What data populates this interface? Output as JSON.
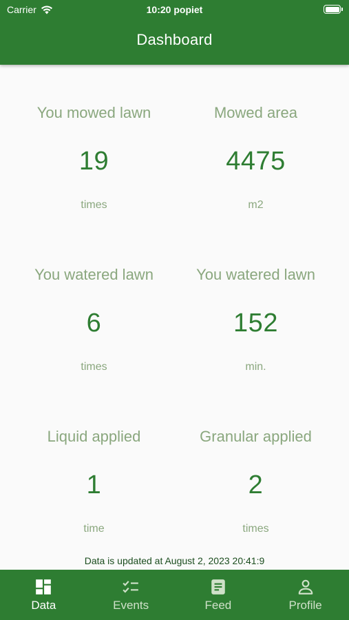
{
  "status_bar": {
    "carrier": "Carrier",
    "time": "10:20 popiet"
  },
  "header": {
    "title": "Dashboard"
  },
  "stats": [
    {
      "label": "You mowed lawn",
      "value": "19",
      "unit": "times"
    },
    {
      "label": "Mowed area",
      "value": "4475",
      "unit": "m2"
    },
    {
      "label": "You watered lawn",
      "value": "6",
      "unit": "times"
    },
    {
      "label": "You watered lawn",
      "value": "152",
      "unit": "min."
    },
    {
      "label": "Liquid applied",
      "value": "1",
      "unit": "time"
    },
    {
      "label": "Granular applied",
      "value": "2",
      "unit": "times"
    }
  ],
  "updated_text": "Data is updated at August 2, 2023 20:41:9",
  "nav": {
    "items": [
      {
        "label": "Data",
        "icon": "dashboard-icon",
        "active": true
      },
      {
        "label": "Events",
        "icon": "checklist-icon",
        "active": false
      },
      {
        "label": "Feed",
        "icon": "article-icon",
        "active": false
      },
      {
        "label": "Profile",
        "icon": "person-icon",
        "active": false
      }
    ]
  },
  "colors": {
    "primary": "#2e7d32",
    "label": "#8aa77e",
    "background": "#fafafa"
  }
}
